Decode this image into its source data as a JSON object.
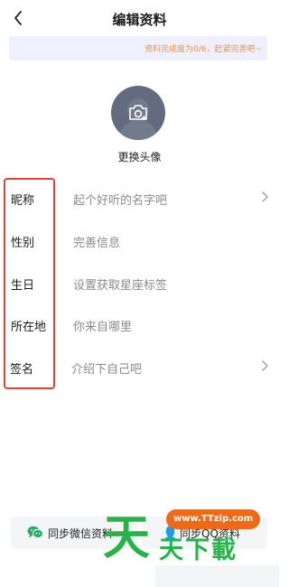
{
  "header": {
    "back_icon": "chevron-left-icon",
    "title": "编辑资料"
  },
  "banner": {
    "text": "资料完成度为0/6，赶紧完善吧~",
    "color": "#f2914e"
  },
  "avatar": {
    "icon": "camera-plus-icon",
    "change_label": "更换头像"
  },
  "form": {
    "rows": [
      {
        "label": "昵称",
        "value": "起个好听的名字吧",
        "chevron": true
      },
      {
        "label": "性别",
        "value": "完善信息",
        "chevron": false
      },
      {
        "label": "生日",
        "value": "设置获取星座标签",
        "chevron": false
      },
      {
        "label": "所在地",
        "value": "你来自哪里",
        "chevron": false
      },
      {
        "label": "签名",
        "value": "介绍下自己吧",
        "chevron": true
      }
    ],
    "highlight_color": "#e0413a"
  },
  "sync": {
    "wechat_label": "同步微信资料",
    "wechat_icon": "wechat-icon",
    "qq_label": "同步QQ资料",
    "qq_icon": "qq-icon"
  },
  "watermark": {
    "url": "www.TTzip.com",
    "big_char": "天",
    "small_text": "天下載"
  }
}
